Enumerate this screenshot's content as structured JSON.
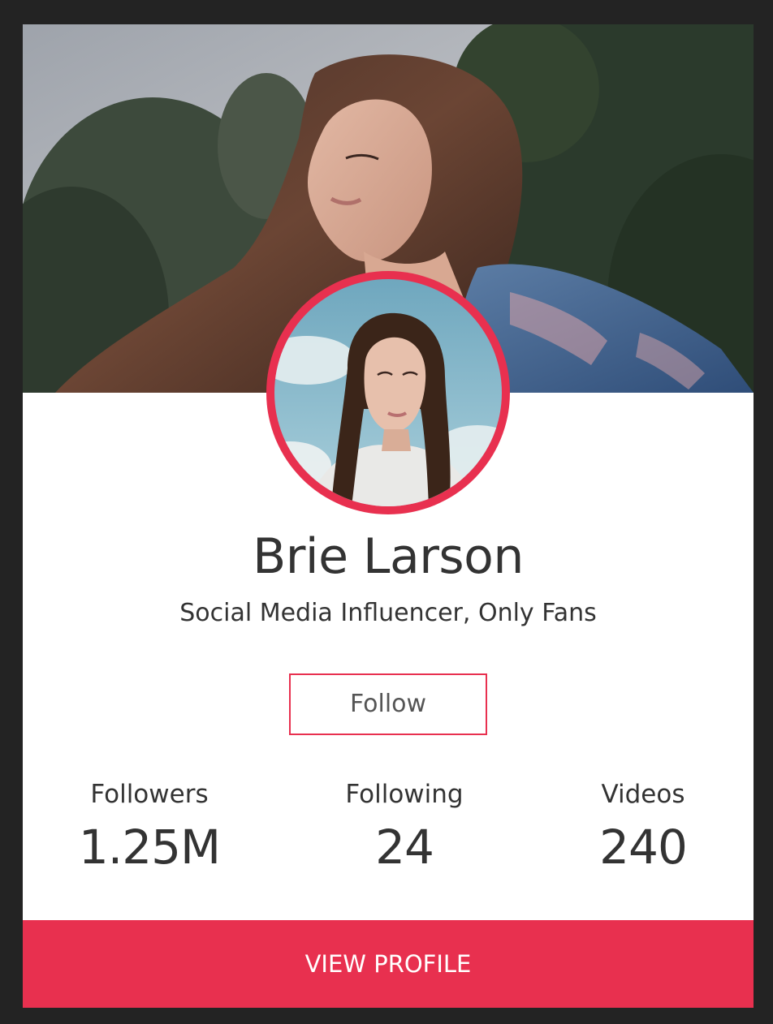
{
  "profile": {
    "name": "Brie Larson",
    "subtitle": "Social Media Influencer, Only Fans",
    "follow_label": "Follow",
    "view_profile_label": "VIEW PROFILE"
  },
  "stats": {
    "followers": {
      "label": "Followers",
      "value": "1.25M"
    },
    "following": {
      "label": "Following",
      "value": "24"
    },
    "videos": {
      "label": "Videos",
      "value": "240"
    }
  },
  "colors": {
    "accent": "#e8304f",
    "text": "#333333",
    "page_background": "#232323",
    "card_background": "#ffffff"
  },
  "images": {
    "cover": "cover-photo-woman-with-long-hair-and-trees",
    "avatar": "avatar-woman-with-braids-blue-sky"
  }
}
